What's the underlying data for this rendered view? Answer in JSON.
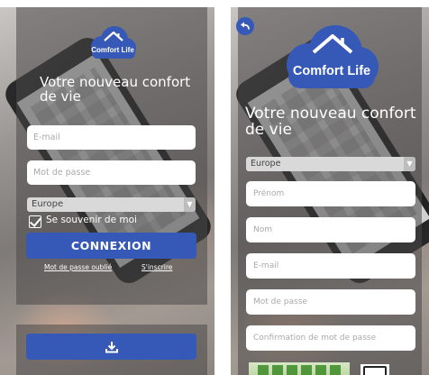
{
  "login": {
    "brand": "Comfort Life",
    "tagline": "Votre nouveau confort de vie",
    "email_placeholder": "E-mail",
    "password_placeholder": "Mot de passe",
    "region_selected": "Europe",
    "remember_label": "Se souvenir de moi",
    "remember_checked": true,
    "login_label": "CONNEXION",
    "forgot_label": "Mot de passe oublié",
    "signup_label": "S'inscrire"
  },
  "register": {
    "brand": "Comfort Life",
    "tagline": "Votre nouveau confort de vie",
    "region_selected": "Europe",
    "firstname_placeholder": "Prénom",
    "name_placeholder": "Nom",
    "email_placeholder": "E-mail",
    "password_placeholder": "Mot de passe",
    "confirm_placeholder": "Confirmation de mot de passe"
  },
  "icons": {
    "logo": "cloud-house-icon",
    "back": "back-arrow-icon",
    "download": "download-icon",
    "checkbox": "check-icon",
    "select_caret": "caret-down-icon",
    "captcha_refresh": "refresh-icon"
  },
  "colors": {
    "primary": "#3658b6",
    "overlay": "#4a4848",
    "input_bg": "#ffffff",
    "select_bg": "#d9d9d9",
    "text_on_dark": "#ffffff"
  }
}
